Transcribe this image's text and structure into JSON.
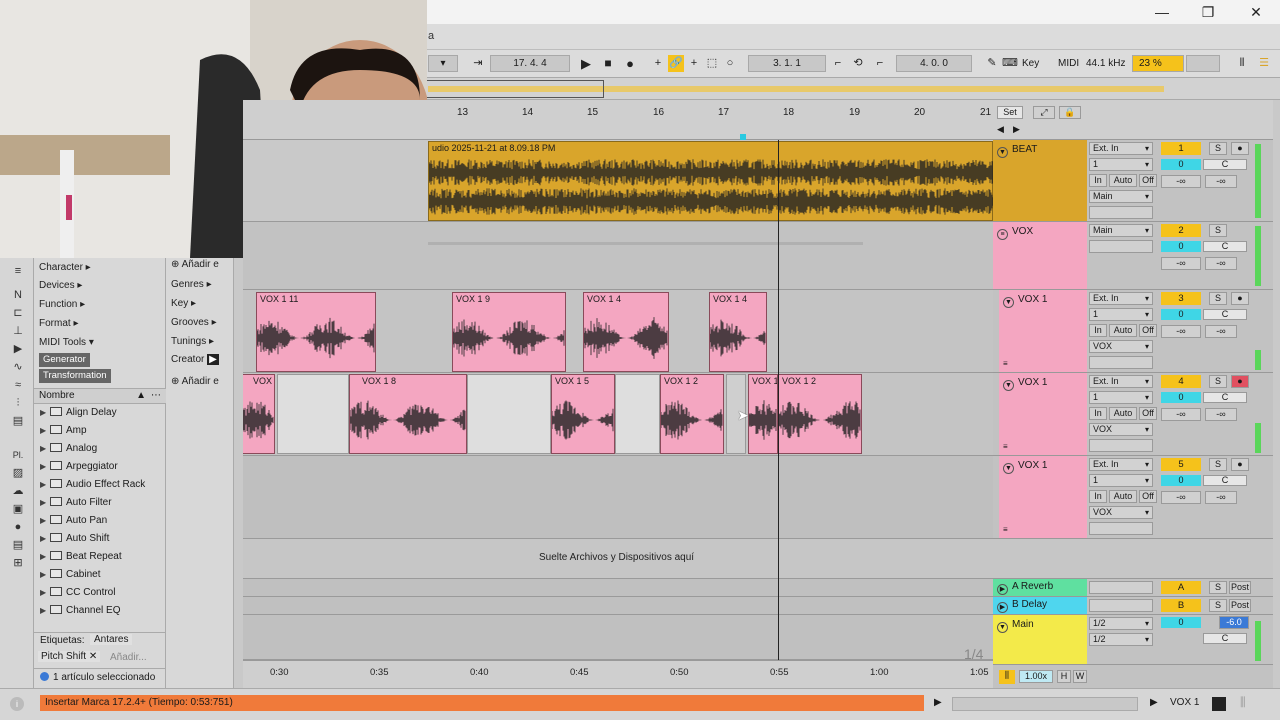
{
  "window": {
    "title_fragment": "a"
  },
  "transport": {
    "position": "17. 4. 4",
    "loop_start": "3. 1. 1",
    "loop_length": "4. 0. 0",
    "key_label": "Key",
    "midi_label": "MIDI",
    "sample_rate": "44.1 kHz",
    "cpu": "23 %"
  },
  "ruler": {
    "bars": [
      "13",
      "14",
      "15",
      "16",
      "17",
      "18",
      "19",
      "20",
      "21"
    ],
    "set_label": "Set"
  },
  "timeline": {
    "times": [
      "0:30",
      "0:35",
      "0:40",
      "0:45",
      "0:50",
      "0:55",
      "1:00",
      "1:05"
    ],
    "page": "1/4",
    "zoom": "1.00x",
    "h_label": "H",
    "w_label": "W"
  },
  "browser": {
    "categories": [
      "Character ▸",
      "Devices ▸",
      "Function ▸",
      "Format ▸",
      "MIDI Tools ▾"
    ],
    "midi_tags": [
      "Generator",
      "Transformation"
    ],
    "mid_items": [
      "Añadir e",
      "Genres ▸",
      "Key ▸",
      "Grooves ▸",
      "Tunings ▸",
      "Creator",
      "Añadir e"
    ],
    "list_header": "Nombre",
    "items": [
      "Align Delay",
      "Amp",
      "Analog",
      "Arpeggiator",
      "Audio Effect Rack",
      "Auto Filter",
      "Auto Pan",
      "Auto Shift",
      "Beat Repeat",
      "Cabinet",
      "CC Control",
      "Channel EQ"
    ],
    "tags_label": "Etiquetas:",
    "tag_value": "Antares",
    "tag_chip": "Pitch Shift",
    "tag_add": "Añadir...",
    "selection": "1 artículo seleccionado",
    "side_label": "Pl."
  },
  "arrangement": {
    "beat_clip": "udio 2025-11-21 at 8.09.18 PM",
    "vox1_clips": [
      "VOX 1 11",
      "VOX 1 9",
      "VOX 1 4",
      "VOX 1 4"
    ],
    "vox2_clips": [
      "VOX",
      "VOX 1 8",
      "VOX 1 5",
      "VOX 1 2",
      "VOX 1",
      "VOX 1 2"
    ],
    "drop_hint": "Suelte Archivos y Dispositivos aquí"
  },
  "tracks": [
    {
      "name": "BEAT",
      "input": "Ext. In",
      "channel": "1",
      "monitor": [
        "In",
        "Auto",
        "Off"
      ],
      "output": "Main",
      "number": "1",
      "vol": "0",
      "pan": "C",
      "sends": [
        "-∞",
        "-∞"
      ],
      "color": "#d9a52b"
    },
    {
      "name": "VOX",
      "input": "Main",
      "number": "2",
      "vol": "0",
      "pan": "C",
      "sends": [
        "-∞",
        "-∞"
      ],
      "color": "#f4a6c1"
    },
    {
      "name": "VOX 1",
      "input": "Ext. In",
      "channel": "1",
      "monitor": [
        "In",
        "Auto",
        "Off"
      ],
      "output": "VOX",
      "number": "3",
      "vol": "0",
      "pan": "C",
      "sends": [
        "-∞",
        "-∞"
      ],
      "color": "#f4a6c1"
    },
    {
      "name": "VOX 1",
      "input": "Ext. In",
      "channel": "1",
      "monitor": [
        "In",
        "Auto",
        "Off"
      ],
      "output": "VOX",
      "number": "4",
      "vol": "0",
      "pan": "C",
      "sends": [
        "-∞",
        "-∞"
      ],
      "color": "#f4a6c1"
    },
    {
      "name": "VOX 1",
      "input": "Ext. In",
      "channel": "1",
      "monitor": [
        "In",
        "Auto",
        "Off"
      ],
      "output": "VOX",
      "number": "5",
      "vol": "0",
      "pan": "C",
      "sends": [
        "-∞",
        "-∞"
      ],
      "color": "#f4a6c1"
    }
  ],
  "returns": [
    {
      "name": "A Reverb",
      "letter": "A",
      "post": "Post",
      "color": "#5fe0a0"
    },
    {
      "name": "B Delay",
      "letter": "B",
      "post": "Post",
      "color": "#4fd6ee"
    }
  ],
  "main": {
    "name": "Main",
    "in1": "1/2",
    "in2": "1/2",
    "vol": "0",
    "db": "-6.0",
    "pan": "C",
    "color": "#f3ea4a"
  },
  "statusbar": {
    "message": "Insertar Marca 17.2.4+ (Tiempo: 0:53:751)",
    "track_label": "VOX 1"
  },
  "colors": {
    "accent": "#f5c21b",
    "beat": "#d9a52b",
    "vox": "#f4a6c1",
    "status": "#f07a3a",
    "volume": "#3fd6e6"
  }
}
